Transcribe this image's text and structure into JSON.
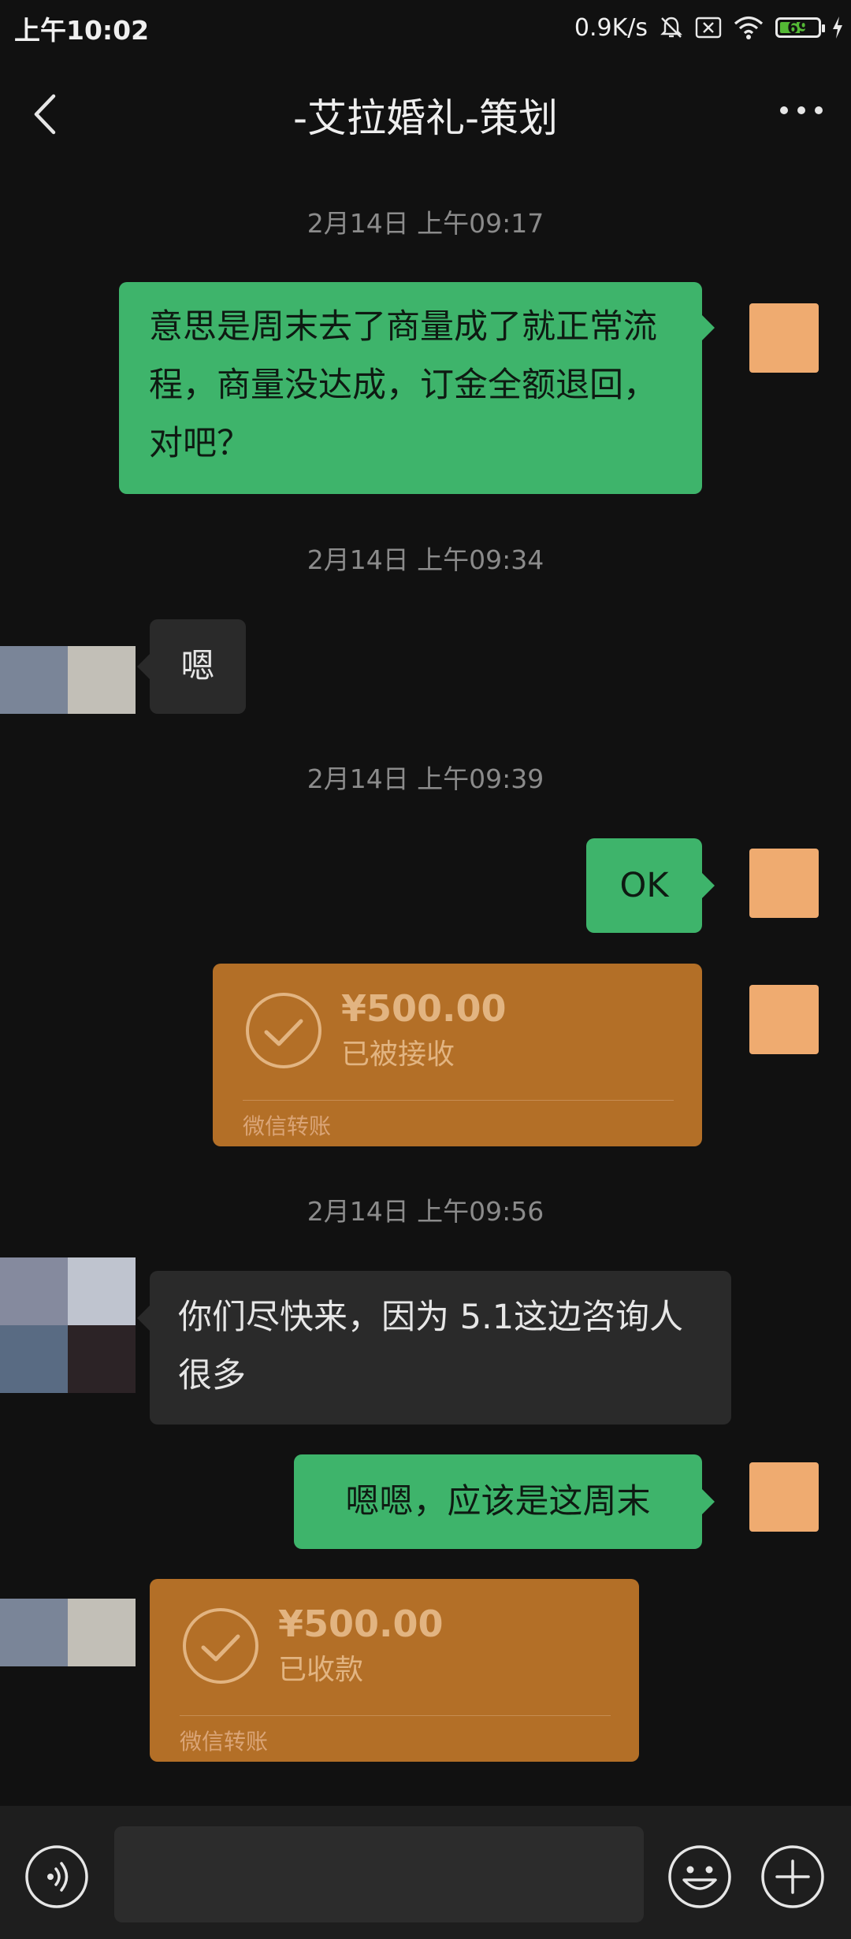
{
  "status_bar": {
    "time": "上午10:02",
    "network_speed": "0.9K/s",
    "battery": "69",
    "battery_level": 0.69
  },
  "header": {
    "title": "-艾拉婚礼-策划"
  },
  "messages": [
    {
      "type": "timestamp",
      "text": "2月14日 上午09:17"
    },
    {
      "type": "text",
      "from": "me",
      "text": "意思是周末去了商量成了就正常流程，商量没达成，订金全额退回，对吧？"
    },
    {
      "type": "timestamp",
      "text": "2月14日 上午09:34"
    },
    {
      "type": "text",
      "from": "other",
      "text": "嗯"
    },
    {
      "type": "timestamp",
      "text": "2月14日 上午09:39"
    },
    {
      "type": "text",
      "from": "me",
      "text": "OK"
    },
    {
      "type": "transfer",
      "from": "me",
      "amount": "¥500.00",
      "status": "已被接收",
      "label": "微信转账"
    },
    {
      "type": "timestamp",
      "text": "2月14日 上午09:56"
    },
    {
      "type": "text",
      "from": "other",
      "text": "你们尽快来，因为 5.1这边咨询人很多"
    },
    {
      "type": "text",
      "from": "me",
      "text": "嗯嗯，应该是这周末"
    },
    {
      "type": "transfer",
      "from": "other",
      "amount": "¥500.00",
      "status": "已收款",
      "label": "微信转账"
    }
  ],
  "colors": {
    "background": "#111111",
    "sent_bubble": "#3eb46b",
    "received_bubble": "#2a2a2a",
    "transfer_card": "#b36f27",
    "my_avatar": "#efab70"
  },
  "icons": {
    "back": "chevron-left-icon",
    "more": "more-dots-icon",
    "voice": "voice-icon",
    "emoji": "emoji-icon",
    "plus": "plus-icon",
    "transfer_done": "check-circle-icon"
  }
}
